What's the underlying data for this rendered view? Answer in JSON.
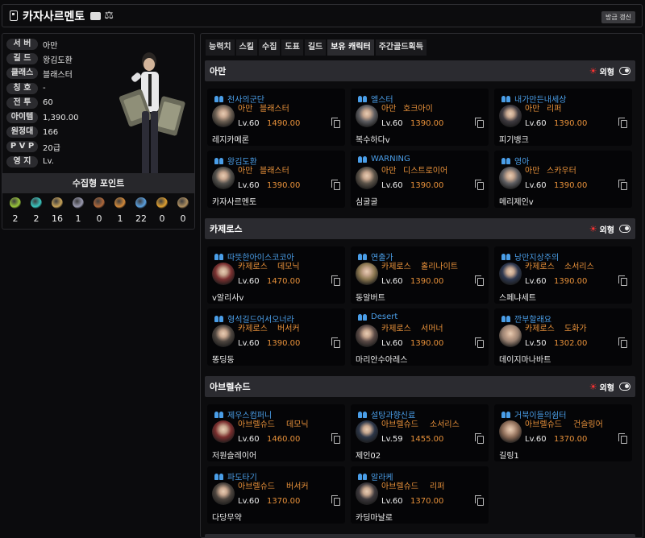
{
  "title": "카자사르멘토",
  "refresh_label": "방금 갱신",
  "profile": {
    "rows": [
      {
        "label": "서 버",
        "value": "아만"
      },
      {
        "label": "길 드",
        "value": "왕김도환"
      },
      {
        "label": "클래스",
        "value": "블래스터"
      },
      {
        "label": "칭 호",
        "value": "-"
      },
      {
        "label": "전 투",
        "value": "60"
      },
      {
        "label": "아이템",
        "value": "1,390.00"
      },
      {
        "label": "원정대",
        "value": "166"
      },
      {
        "label": "P V P",
        "value": "20급"
      },
      {
        "label": "영 지",
        "value": "Lv."
      }
    ]
  },
  "points": {
    "header": "수집형 포인트",
    "items": [
      {
        "icon": "mokoko-seed-icon",
        "color": "#9ac83a",
        "count": "2"
      },
      {
        "icon": "island-heart-icon",
        "color": "#39c7c0",
        "count": "2"
      },
      {
        "icon": "great-art-icon",
        "color": "#c9a45a",
        "count": "16"
      },
      {
        "icon": "giant-heart-icon",
        "color": "#9a9ab0",
        "count": "1"
      },
      {
        "icon": "ignea-token-icon",
        "color": "#b0683a",
        "count": "0"
      },
      {
        "icon": "sea-bounty-icon",
        "color": "#d48a3a",
        "count": "1"
      },
      {
        "icon": "world-tree-leaf-icon",
        "color": "#5aa0e0",
        "count": "22"
      },
      {
        "icon": "orpheus-star-icon",
        "color": "#e0a030",
        "count": "0"
      },
      {
        "icon": "memory-orgel-icon",
        "color": "#b09060",
        "count": "0"
      }
    ]
  },
  "tabs": [
    "능력치",
    "스킬",
    "수집",
    "도표",
    "길드",
    "보유 캐릭터",
    "주간골드획득"
  ],
  "active_tab": 5,
  "look_label": "외형",
  "servers": [
    {
      "name": "아만",
      "chars": [
        {
          "guild": "천사의군단",
          "server": "아만",
          "class": "블래스터",
          "level": "Lv.60",
          "item_level": "1490.00",
          "name": "레지카메론",
          "portrait": "#6a5e52"
        },
        {
          "guild": "엘스터",
          "server": "아만",
          "class": "호크아이",
          "level": "Lv.60",
          "item_level": "1390.00",
          "name": "복수하다v",
          "portrait": "#5c5c60"
        },
        {
          "guild": "내가만든내세상",
          "server": "아만",
          "class": "리퍼",
          "level": "Lv.60",
          "item_level": "1390.00",
          "name": "피기뱅크",
          "portrait": "#3e3a40"
        },
        {
          "guild": "왕김도환",
          "server": "아만",
          "class": "블래스터",
          "level": "Lv.60",
          "item_level": "1390.00",
          "name": "카자사르멘토",
          "portrait": "#52504c"
        },
        {
          "guild": "WARNING",
          "server": "아만",
          "class": "디스트로이어",
          "level": "Lv.60",
          "item_level": "1390.00",
          "name": "심굴굴",
          "portrait": "#5a5248"
        },
        {
          "guild": "영아",
          "server": "아만",
          "class": "스카우터",
          "level": "Lv.60",
          "item_level": "1390.00",
          "name": "메리제인v",
          "portrait": "#5e5e62"
        }
      ]
    },
    {
      "name": "카제로스",
      "chars": [
        {
          "guild": "따뜻한아이스코코아",
          "server": "카제로스",
          "class": "데모닉",
          "level": "Lv.60",
          "item_level": "1470.00",
          "name": "v알리사v",
          "portrait": "#7a3030"
        },
        {
          "guild": "연출가",
          "server": "카제로스",
          "class": "홀리나이트",
          "level": "Lv.60",
          "item_level": "1390.00",
          "name": "동알버트",
          "portrait": "#8a7650"
        },
        {
          "guild": "낭만지상주의",
          "server": "카제로스",
          "class": "소서리스",
          "level": "Lv.60",
          "item_level": "1390.00",
          "name": "스페냐세트",
          "portrait": "#2e3850"
        },
        {
          "guild": "형석길드어서오너라",
          "server": "카제로스",
          "class": "버서커",
          "level": "Lv.60",
          "item_level": "1390.00",
          "name": "똥딩동",
          "portrait": "#4e4640"
        },
        {
          "guild": "Desert",
          "server": "카제로스",
          "class": "서머너",
          "level": "Lv.60",
          "item_level": "1390.00",
          "name": "마리안수아레스",
          "portrait": "#5a4a46"
        },
        {
          "guild": "깐부할래요",
          "server": "카제로스",
          "class": "도화가",
          "level": "Lv.50",
          "item_level": "1302.00",
          "name": "데이지마나바트",
          "portrait": "#9a8272"
        }
      ]
    },
    {
      "name": "아브렐슈드",
      "chars": [
        {
          "guild": "제우스컴퍼니",
          "server": "아브렐슈드",
          "class": "데모닉",
          "level": "Lv.60",
          "item_level": "1460.00",
          "name": "저원슬레이어",
          "portrait": "#7a2e2e"
        },
        {
          "guild": "설탕과향신료",
          "server": "아브렐슈드",
          "class": "소서리스",
          "level": "Lv.59",
          "item_level": "1455.00",
          "name": "제인02",
          "portrait": "#2c3648"
        },
        {
          "guild": "거북이들의쉼터",
          "server": "아브렐슈드",
          "class": "건슬링어",
          "level": "Lv.60",
          "item_level": "1370.00",
          "name": "길링1",
          "portrait": "#8a6a56"
        },
        {
          "guild": "파도타기",
          "server": "아브렐슈드",
          "class": "버서커",
          "level": "Lv.60",
          "item_level": "1370.00",
          "name": "다당무약",
          "portrait": "#4c443e"
        },
        {
          "guild": "알라케",
          "server": "아브렐슈드",
          "class": "리퍼",
          "level": "Lv.60",
          "item_level": "1370.00",
          "name": "카딩마날로",
          "portrait": "#3c383c"
        }
      ]
    }
  ]
}
